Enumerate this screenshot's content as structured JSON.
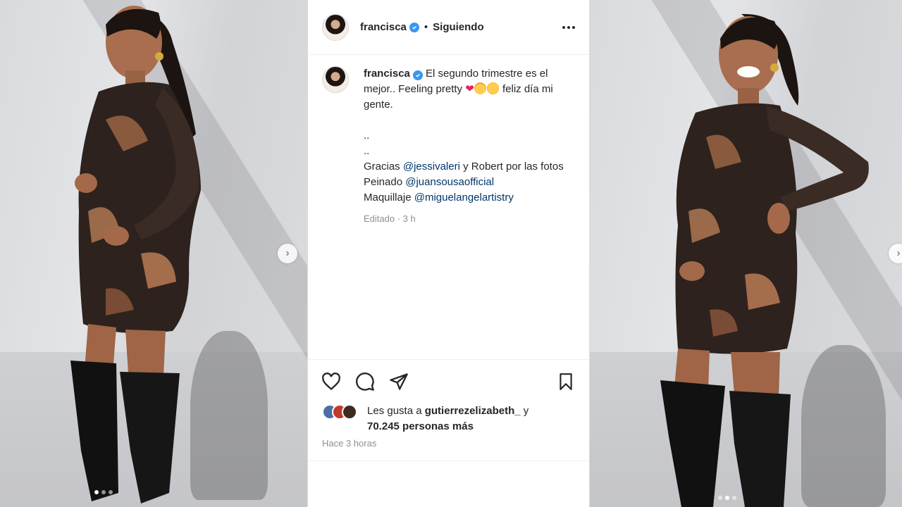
{
  "post": {
    "username": "francisca",
    "follow_status": "Siguiendo",
    "separator": "•",
    "caption": {
      "username": "francisca",
      "line1": "El segundo trimestre es el mejor.. Feeling pretty",
      "line1_tail": "feliz día mi gente.",
      "dots1": "..",
      "dots2": "..",
      "gracias_prefix": "Gracias",
      "mention1": "@jessivaleri",
      "gracias_suffix": "y Robert por las fotos",
      "peinado_prefix": "Peinado",
      "mention2": "@juansousaofficial",
      "maquillaje_prefix": "Maquillaje",
      "mention3": "@miguelangelartistry",
      "edited": "Editado · 3 h"
    },
    "likes": {
      "prefix": "Les gusta a",
      "user": "gutierrezelizabeth_",
      "connector": "y",
      "count_text": "70.245 personas más"
    },
    "time_ago": "Hace 3 horas"
  },
  "icons": {
    "header": [
      "verified-badge-icon",
      "more-options-icon"
    ],
    "actions": [
      "heart-icon",
      "comment-icon",
      "share-icon",
      "bookmark-icon"
    ],
    "carousel": [
      "chevron-right-icon"
    ]
  },
  "colors": {
    "verified": "#3897f0",
    "mention": "#00376b",
    "muted": "#8e8e8e",
    "text": "#262626"
  },
  "carousel": {
    "slides": 3,
    "active_slide_left": 1,
    "active_slide_right": 2
  }
}
